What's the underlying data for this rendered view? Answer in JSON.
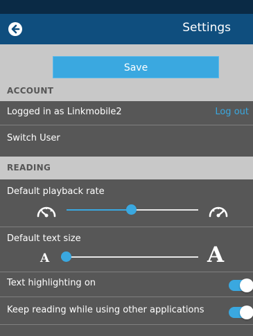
{
  "header": {
    "title": "Settings",
    "back_icon": "back-arrow-circle-icon"
  },
  "save_label": "Save",
  "account": {
    "heading": "ACCOUNT",
    "logged_in_text": "Logged in as Linkmobile2",
    "logout_label": "Log out",
    "switch_user_label": "Switch User"
  },
  "reading": {
    "heading": "READING",
    "playback_rate_label": "Default playback rate",
    "playback_rate_level": 0.49,
    "text_size_label": "Default text size",
    "text_size_level": 0.0,
    "small_a": "A",
    "large_a": "A",
    "highlighting_label": "Text highlighting on",
    "highlighting_on": true,
    "keep_reading_label": "Keep reading while using other applications",
    "keep_reading_on": true
  },
  "colors": {
    "accent": "#3aa8e0",
    "header": "#0f4e7e",
    "row_bg": "#575757",
    "section_bg": "#c8c8c8"
  }
}
